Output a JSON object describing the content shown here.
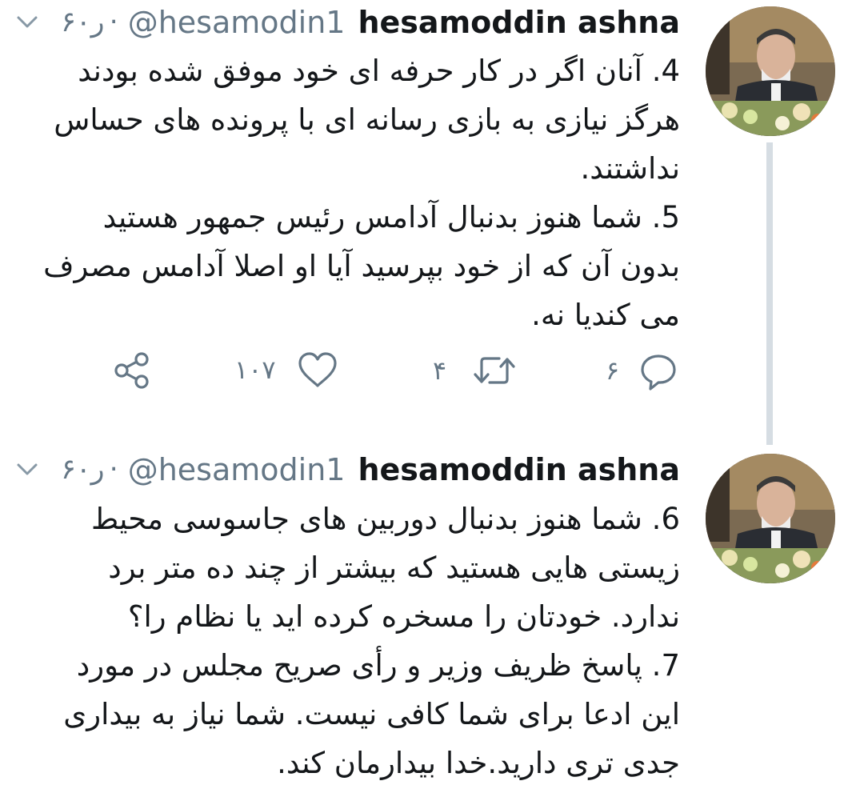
{
  "tweets": [
    {
      "author": {
        "name": "hesamoddin ashna",
        "handle": "@hesamodin1",
        "time": "۶۰ر",
        "separator": "·"
      },
      "paragraphs": [
        "4. آنان اگر در کار حرفه ای خود موفق شده بودند هرگز نیازی به بازی رسانه ای با پرونده های حساس نداشتند.",
        "5. شما هنوز بدنبال آدامس رئیس جمهور هستید بدون آن که از خود بپرسید آیا او اصلا آدامس مصرف می کندیا نه."
      ],
      "actions": {
        "replies": "۶",
        "retweets": "۴",
        "likes": "۱۰۷"
      }
    },
    {
      "author": {
        "name": "hesamoddin ashna",
        "handle": "@hesamodin1",
        "time": "۶۰ر",
        "separator": "·"
      },
      "paragraphs": [
        "6. شما هنوز بدنبال دوربین های جاسوسی محیط زیستی هایی هستید که بیشتر از چند ده متر برد ندارد. خودتان را مسخره کرده اید یا نظام را؟",
        "7. پاسخ ظریف وزیر و رأی صریح مجلس در مورد این ادعا برای شما کافی نیست. شما نیاز به بیداری جدی تری دارید.خدا بیدارمان کند."
      ]
    }
  ],
  "icons": {
    "caret": "chevron-down-icon",
    "reply": "reply-icon",
    "retweet": "retweet-icon",
    "like": "heart-icon",
    "share": "share-icon"
  },
  "colors": {
    "text": "#14171a",
    "secondary": "#657786",
    "thread_line": "#d6dde3"
  }
}
